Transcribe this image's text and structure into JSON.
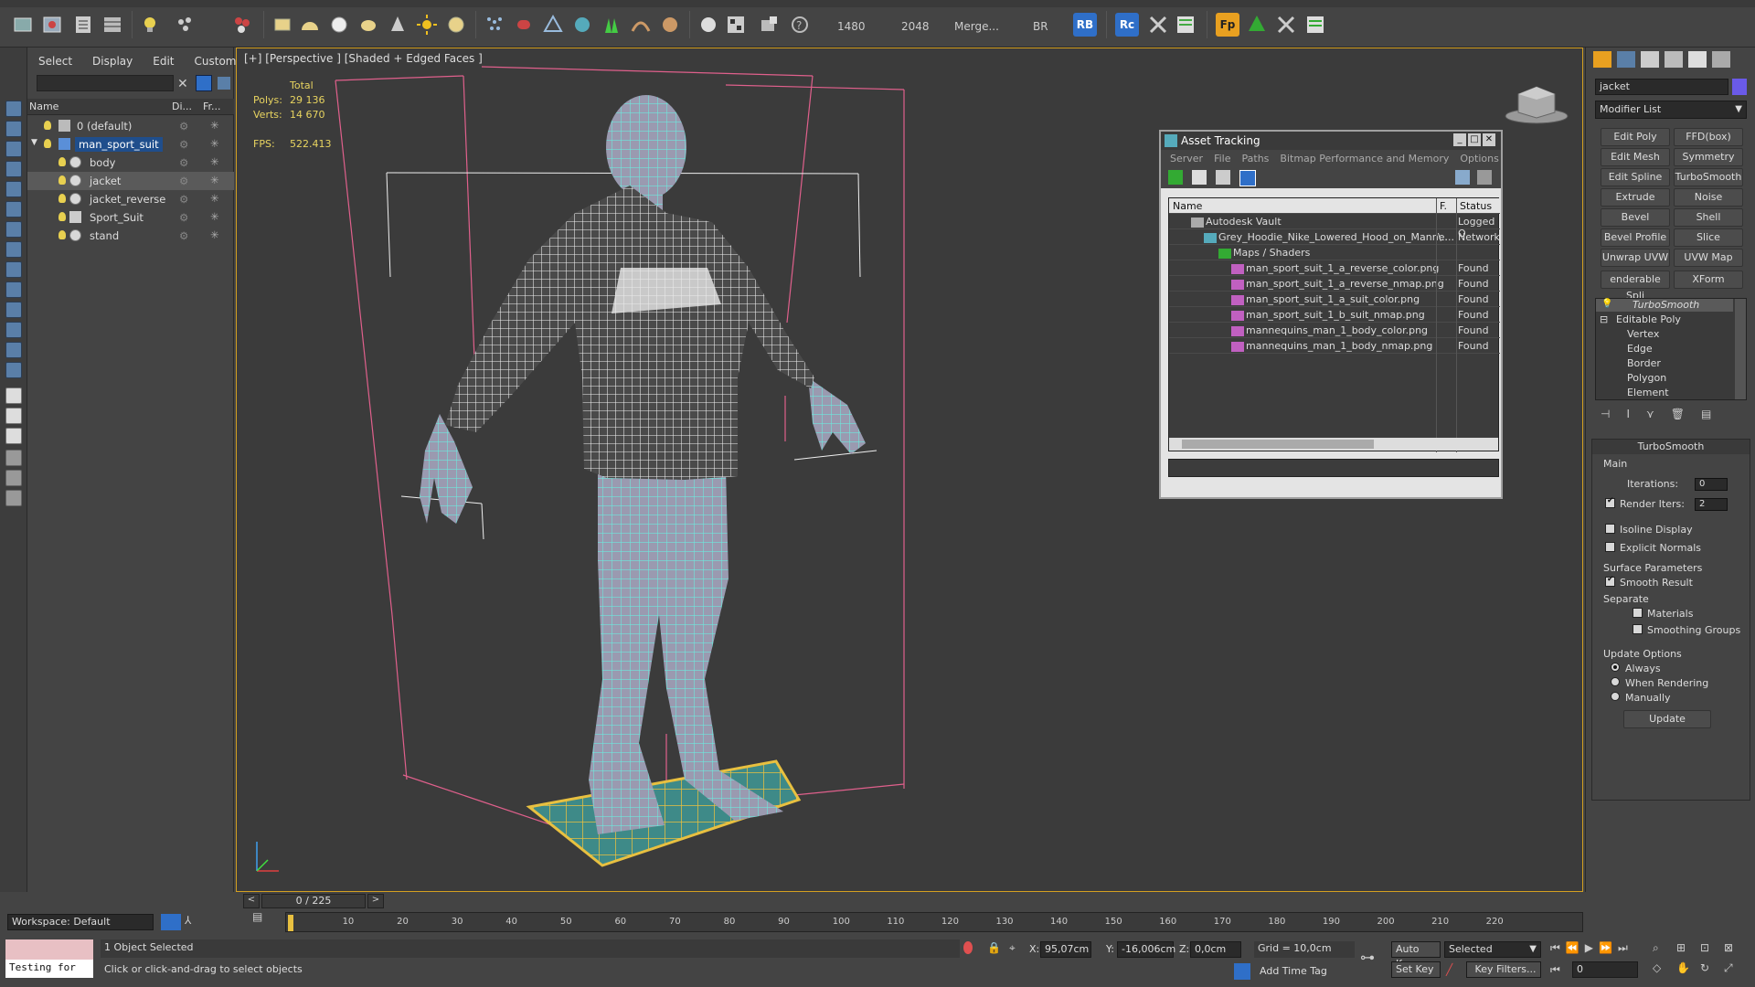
{
  "toolbar": {
    "render_width": "1480",
    "render_height": "2048",
    "merge_label": "Merge...",
    "br_label": "BR",
    "rb_label": "RB",
    "rc_label": "Rc",
    "fp_label": "Fp"
  },
  "scene": {
    "menu": [
      "Select",
      "Display",
      "Edit",
      "Customize"
    ],
    "columns": {
      "name": "Name",
      "display": "Di...",
      "freeze": "Fr..."
    },
    "rows": [
      {
        "label": "0 (default)"
      },
      {
        "label": "man_sport_suit"
      },
      {
        "label": "body"
      },
      {
        "label": "jacket"
      },
      {
        "label": "jacket_reverse"
      },
      {
        "label": "Sport_Suit"
      },
      {
        "label": "stand"
      }
    ]
  },
  "viewport": {
    "label": "[+] [Perspective ] [Shaded + Edged Faces ]",
    "stats": {
      "total": "Total",
      "polys_label": "Polys:",
      "polys": "29 136",
      "verts_label": "Verts:",
      "verts": "14 670",
      "fps_label": "FPS:",
      "fps": "522.413"
    }
  },
  "asset": {
    "title": "Asset Tracking",
    "menu": [
      "Server",
      "File",
      "Paths",
      "Bitmap Performance and Memory",
      "Options"
    ],
    "columns": {
      "name": "Name",
      "f": "F.",
      "status": "Status"
    },
    "rows": [
      {
        "name": "Autodesk Vault",
        "f": "",
        "status": "Logged O"
      },
      {
        "name": "Grey_Hoodie_Nike_Lowered_Hood_on_Manne...",
        "f": "\\..",
        "status": "Network"
      },
      {
        "name": "Maps / Shaders",
        "f": "",
        "status": ""
      },
      {
        "name": "man_sport_suit_1_a_reverse_color.png",
        "f": "",
        "status": "Found"
      },
      {
        "name": "man_sport_suit_1_a_reverse_nmap.png",
        "f": "",
        "status": "Found"
      },
      {
        "name": "man_sport_suit_1_a_suit_color.png",
        "f": "",
        "status": "Found"
      },
      {
        "name": "man_sport_suit_1_b_suit_nmap.png",
        "f": "",
        "status": "Found"
      },
      {
        "name": "mannequins_man_1_body_color.png",
        "f": "",
        "status": "Found"
      },
      {
        "name": "mannequins_man_1_body_nmap.png",
        "f": "",
        "status": "Found"
      }
    ]
  },
  "cmd": {
    "object_name": "jacket",
    "modifier_list": "Modifier List",
    "buttons": [
      [
        "Edit Poly",
        "FFD(box)"
      ],
      [
        "Edit Mesh",
        "Symmetry"
      ],
      [
        "Edit Spline",
        "TurboSmooth"
      ],
      [
        "Extrude",
        "Noise"
      ],
      [
        "Bevel",
        "Shell"
      ],
      [
        "Bevel Profile",
        "Slice"
      ],
      [
        "Unwrap UVW",
        "UVW Map"
      ],
      [
        "enderable Spli",
        "XForm"
      ]
    ],
    "stack": [
      "TurboSmooth",
      "Editable Poly",
      "Vertex",
      "Edge",
      "Border",
      "Polygon",
      "Element"
    ],
    "rollout_title": "TurboSmooth",
    "main": "Main",
    "iterations_label": "Iterations:",
    "iterations": "0",
    "render_iters_label": "Render Iters:",
    "render_iters": "2",
    "isoline": "Isoline Display",
    "explicit": "Explicit Normals",
    "surface": "Surface Parameters",
    "smooth_result": "Smooth Result",
    "separate": "Separate",
    "materials": "Materials",
    "smoothing_groups": "Smoothing Groups",
    "update_options": "Update Options",
    "always": "Always",
    "when_rendering": "When Rendering",
    "manually": "Manually",
    "update": "Update"
  },
  "bottom": {
    "workspace": "Workspace: Default",
    "frame": "0 / 225",
    "ticks": [
      "10",
      "20",
      "30",
      "40",
      "50",
      "60",
      "70",
      "80",
      "90",
      "100",
      "110",
      "120",
      "130",
      "140",
      "150",
      "160",
      "170",
      "180",
      "190",
      "200",
      "210",
      "220"
    ],
    "listener": "Testing for",
    "selected": "1 Object Selected",
    "prompt": "Click or click-and-drag to select objects",
    "x_label": "X:",
    "x": "95,07cm",
    "y_label": "Y:",
    "y": "-16,006cm",
    "z_label": "Z:",
    "z": "0,0cm",
    "grid": "Grid = 10,0cm",
    "add_time_tag": "Add Time Tag",
    "auto_key": "Auto Key",
    "set_key": "Set Key",
    "selected_dd": "Selected",
    "key_filters": "Key Filters...",
    "frame_field": "0"
  },
  "colors": {
    "accent_blue": "#1f4e8c",
    "wire_cyan": "#6ee8dc",
    "bbox_pink": "#e0608c",
    "stats_yellow": "#e8d460",
    "viewport_border": "#d4a020"
  }
}
